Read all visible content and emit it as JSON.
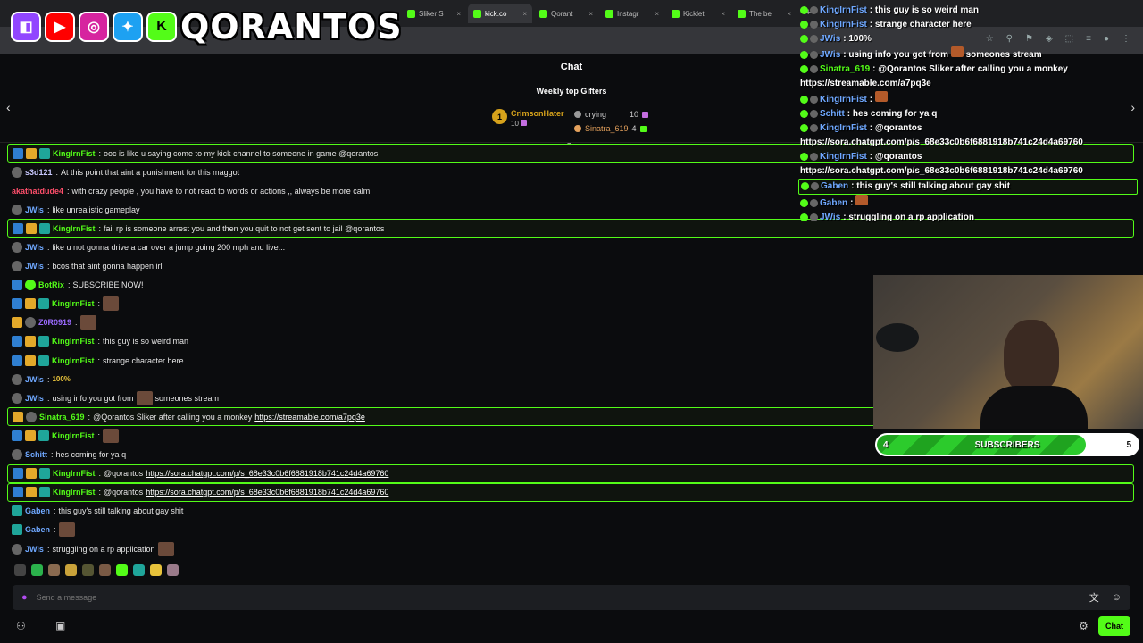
{
  "browser": {
    "tabs": [
      {
        "label": "Sliker S",
        "active": false
      },
      {
        "label": "kick.co",
        "active": true
      },
      {
        "label": "Qorant",
        "active": false
      },
      {
        "label": "Instagr",
        "active": false
      },
      {
        "label": "Kicklet",
        "active": false
      },
      {
        "label": "The be",
        "active": false
      }
    ],
    "new_tab": "+"
  },
  "brand": {
    "text": "QORANTOS",
    "icons": [
      "twitch-icon",
      "youtube-icon",
      "instagram-icon",
      "twitter-icon",
      "kick-icon"
    ]
  },
  "chat": {
    "title": "Chat",
    "gifters_title": "Weekly top Gifters",
    "gifters": [
      {
        "rank": "1",
        "name": "CrimsonHater",
        "count": "10"
      },
      {
        "name": "crying",
        "count": "10"
      },
      {
        "name": "Sinatra_619",
        "count": "4"
      }
    ],
    "messages": [
      {
        "user": "KingIrnFist",
        "color": "#53fc18",
        "text": "ooc is like u saying come to my kick channel to someone in game @qorantos",
        "badges": [
          "blue",
          "gold",
          "teal"
        ],
        "highlight": true
      },
      {
        "user": "s3d121",
        "color": "#c9c9ff",
        "text": "At this point that aint a punishment for this maggot",
        "badges": [
          "gray"
        ]
      },
      {
        "user": "akathatdude4",
        "color": "#ff4f6b",
        "text": "with crazy people , you have to not react to words or actions ,, always be more calm",
        "badges": []
      },
      {
        "user": "JWis",
        "color": "#6fa8ff",
        "text": "like unrealistic gameplay",
        "badges": [
          "gray"
        ]
      },
      {
        "user": "KingIrnFist",
        "color": "#53fc18",
        "text": "fail rp is someone arrest you and then you quit to not get sent to jail @qorantos",
        "badges": [
          "blue",
          "gold",
          "teal"
        ],
        "highlight": true
      },
      {
        "user": "JWis",
        "color": "#6fa8ff",
        "text": "like u not gonna drive a car over a jump going 200 mph and live...",
        "badges": [
          "gray"
        ]
      },
      {
        "user": "JWis",
        "color": "#6fa8ff",
        "text": "bcos that aint gonna happen irl",
        "badges": [
          "gray"
        ]
      },
      {
        "user": "BotRix",
        "color": "#53fc18",
        "text": "SUBSCRIBE NOW!",
        "badges": [
          "blue",
          "green"
        ]
      },
      {
        "user": "KingIrnFist",
        "color": "#53fc18",
        "text": "",
        "badges": [
          "blue",
          "gold",
          "teal"
        ],
        "emote": true
      },
      {
        "user": "Z0R0919",
        "color": "#9b6bff",
        "text": "",
        "badges": [
          "gold",
          "gray"
        ],
        "emote": true
      },
      {
        "user": "KingIrnFist",
        "color": "#53fc18",
        "text": "this guy is so weird man",
        "badges": [
          "blue",
          "gold",
          "teal"
        ]
      },
      {
        "user": "KingIrnFist",
        "color": "#53fc18",
        "text": "strange character here",
        "badges": [
          "blue",
          "gold",
          "teal"
        ]
      },
      {
        "user": "JWis",
        "color": "#6fa8ff",
        "text": "100%",
        "badges": [
          "gray"
        ],
        "tag": true
      },
      {
        "user": "JWis",
        "color": "#6fa8ff",
        "text": "using info you got from",
        "after": "someones stream",
        "badges": [
          "gray"
        ],
        "emote": true
      },
      {
        "user": "Sinatra_619",
        "color": "#53fc18",
        "text": "@Qorantos Sliker after calling you a monkey",
        "link": "https://streamable.com/a7pq3e",
        "badges": [
          "gold",
          "gray"
        ],
        "highlight": true
      },
      {
        "user": "KingIrnFist",
        "color": "#53fc18",
        "text": "",
        "badges": [
          "blue",
          "gold",
          "teal"
        ],
        "emote": true
      },
      {
        "user": "Schitt",
        "color": "#6fa8ff",
        "text": "hes coming for ya q",
        "badges": [
          "gray"
        ]
      },
      {
        "user": "KingIrnFist",
        "color": "#53fc18",
        "text": "@qorantos",
        "link": "https://sora.chatgpt.com/p/s_68e33c0b6f6881918b741c24d4a69760",
        "badges": [
          "blue",
          "gold",
          "teal"
        ],
        "highlight": true
      },
      {
        "user": "KingIrnFist",
        "color": "#53fc18",
        "text": "@qorantos",
        "link": "https://sora.chatgpt.com/p/s_68e33c0b6f6881918b741c24d4a69760",
        "badges": [
          "blue",
          "gold",
          "teal"
        ],
        "highlight": true
      },
      {
        "user": "Gaben",
        "color": "#6fa8ff",
        "text": "this guy's still talking about gay shit",
        "badges": [
          "teal"
        ]
      },
      {
        "user": "Gaben",
        "color": "#6fa8ff",
        "text": "",
        "badges": [
          "teal"
        ],
        "emote": true
      },
      {
        "user": "JWis",
        "color": "#6fa8ff",
        "text": "struggling on a rp application",
        "badges": [
          "gray"
        ],
        "emote": true
      }
    ],
    "input_placeholder": "Send a message",
    "chat_button": "Chat"
  },
  "overlay": {
    "messages": [
      {
        "user": "KingIrnFist",
        "color": "#6fa8ff",
        "text": "this guy is so weird man"
      },
      {
        "user": "KingIrnFist",
        "color": "#6fa8ff",
        "text": "strange character here"
      },
      {
        "user": "JWis",
        "color": "#6fa8ff",
        "text": "100%"
      },
      {
        "user": "JWis",
        "color": "#6fa8ff",
        "text": "using info you got from",
        "after": "someones stream"
      },
      {
        "user": "Sinatra_619",
        "color": "#53fc18",
        "text": "@Qorantos Sliker after calling you a monkey https://streamable.com/a7pq3e"
      },
      {
        "user": "KingIrnFist",
        "color": "#6fa8ff",
        "text": ""
      },
      {
        "user": "Schitt",
        "color": "#6fa8ff",
        "text": "hes coming for ya q"
      },
      {
        "user": "KingIrnFist",
        "color": "#6fa8ff",
        "text": "@qorantos https://sora.chatgpt.com/p/s_68e33c0b6f6881918b741c24d4a69760"
      },
      {
        "user": "KingIrnFist",
        "color": "#6fa8ff",
        "text": "@qorantos https://sora.chatgpt.com/p/s_68e33c0b6f6881918b741c24d4a69760"
      },
      {
        "user": "Gaben",
        "color": "#6fa8ff",
        "text": "this guy's still talking about gay shit",
        "highlight": true
      },
      {
        "user": "Gaben",
        "color": "#6fa8ff",
        "text": ""
      },
      {
        "user": "JWis",
        "color": "#6fa8ff",
        "text": "struggling on a rp application"
      }
    ]
  },
  "subgoal": {
    "current": "4",
    "label": "SUBSCRIBERS",
    "target": "5",
    "progress": 0.8
  }
}
